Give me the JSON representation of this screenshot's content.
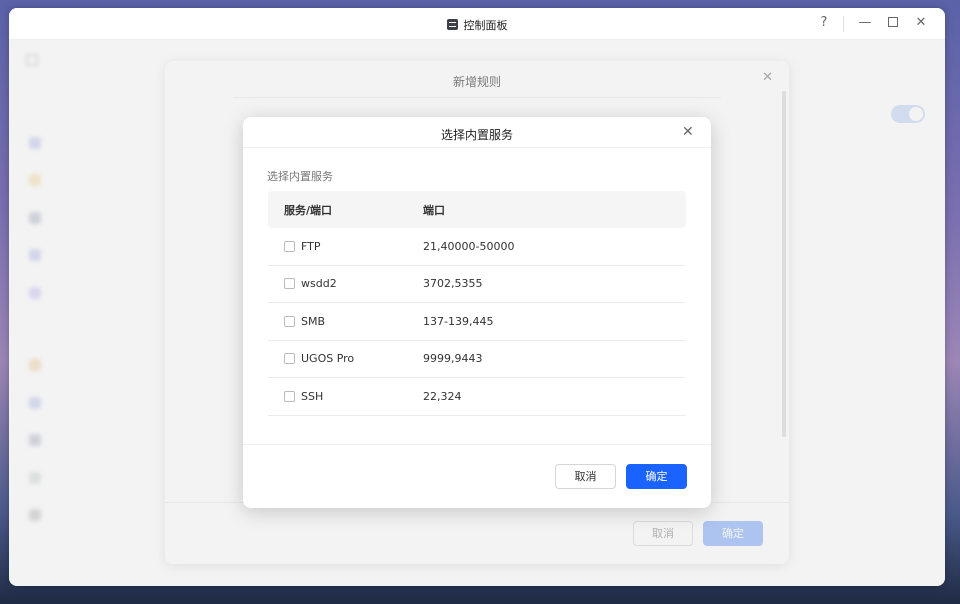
{
  "window": {
    "title": "控制面板",
    "help": "?",
    "minimize": "—",
    "close": "✕"
  },
  "background_dialog": {
    "title": "新增规则",
    "close": "✕",
    "cancel_label": "取消",
    "ok_label": "确定"
  },
  "service_dialog": {
    "title": "选择内置服务",
    "close": "✕",
    "section_label": "选择内置服务",
    "columns": [
      "服务/端口",
      "端口"
    ],
    "rows": [
      {
        "name": "FTP",
        "ports": "21,40000-50000",
        "checked": false
      },
      {
        "name": "wsdd2",
        "ports": "3702,5355",
        "checked": false
      },
      {
        "name": "SMB",
        "ports": "137-139,445",
        "checked": false
      },
      {
        "name": "UGOS Pro",
        "ports": "9999,9443",
        "checked": false
      },
      {
        "name": "SSH",
        "ports": "22,324",
        "checked": false
      }
    ],
    "cancel_label": "取消",
    "ok_label": "确定"
  },
  "colors": {
    "primary": "#1a63ff",
    "primary_disabled": "#95b7fb"
  }
}
